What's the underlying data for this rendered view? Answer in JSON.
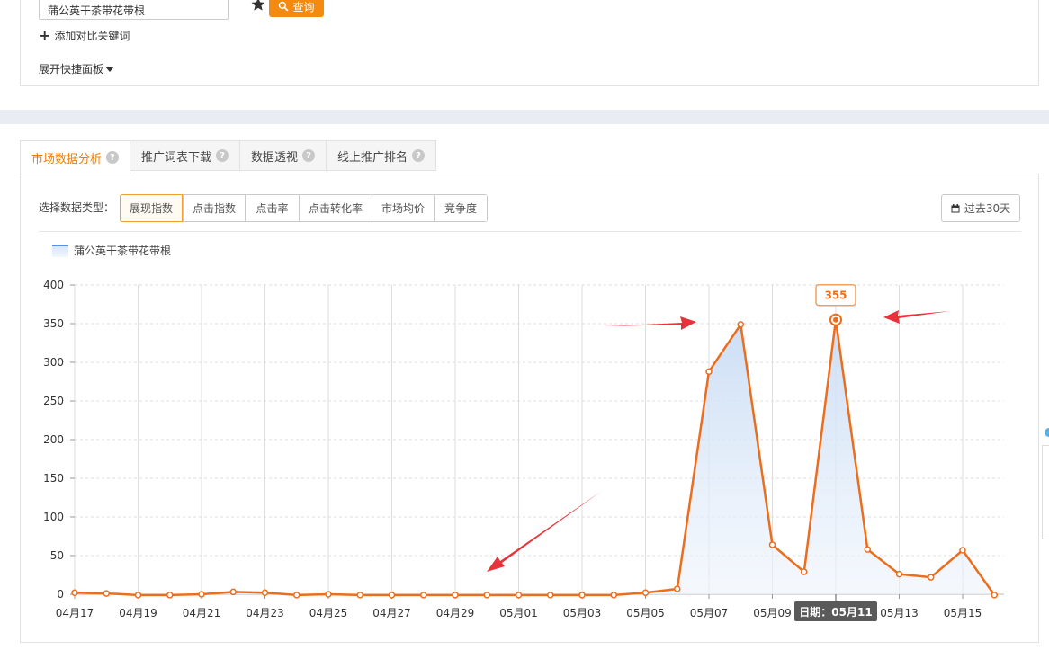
{
  "search": {
    "keyword": "蒲公英干茶带花带根",
    "query_label": "查询",
    "add_compare_label": "添加对比关键词",
    "expand_panel_label": "展开快捷面板"
  },
  "tabs": [
    {
      "label": "市场数据分析",
      "active": true
    },
    {
      "label": "推广词表下载",
      "active": false
    },
    {
      "label": "数据透视",
      "active": false
    },
    {
      "label": "线上推广排名",
      "active": false
    }
  ],
  "filters": {
    "type_label": "选择数据类型：",
    "types": [
      "展现指数",
      "点击指数",
      "点击率",
      "点击转化率",
      "市场均价",
      "竞争度"
    ],
    "selected_type": "展现指数",
    "period_label": "过去30天"
  },
  "colors": {
    "accent": "#f48b0f",
    "line": "#ec6d1c",
    "area": "#cfe0f5",
    "annotation_arrow": "#e8333a"
  },
  "chart_data": {
    "type": "area",
    "legend": "蒲公英干茶带花带根",
    "x": [
      "04月17",
      "04月18",
      "04月19",
      "04月20",
      "04月21",
      "04月22",
      "04月23",
      "04月24",
      "04月25",
      "04月26",
      "04月27",
      "04月28",
      "04月29",
      "04月30",
      "05月01",
      "05月02",
      "05月03",
      "05月04",
      "05月05",
      "05月06",
      "05月07",
      "05月08",
      "05月09",
      "05月10",
      "05月11",
      "05月12",
      "05月13",
      "05月14",
      "05月15",
      "05月16"
    ],
    "x_tick_labels": [
      "04月17",
      "04月19",
      "04月21",
      "04月23",
      "04月25",
      "04月27",
      "04月29",
      "05月01",
      "05月03",
      "05月05",
      "05月07",
      "05月09",
      "05月11",
      "05月13",
      "05月15"
    ],
    "values": [
      2,
      1,
      -1,
      -1,
      0,
      3,
      2,
      -1,
      0,
      -1,
      -1,
      -1,
      -1,
      -1,
      -1,
      -1,
      -1,
      -1,
      2,
      7,
      288,
      349,
      64,
      29,
      355,
      58,
      26,
      22,
      57,
      -1
    ],
    "ylim": [
      0,
      400
    ],
    "y_ticks": [
      0,
      50,
      100,
      150,
      200,
      250,
      300,
      350,
      400
    ],
    "grid": true,
    "highlight": {
      "index": 24,
      "value_label": "355",
      "date_label": "日期：05月11"
    }
  }
}
